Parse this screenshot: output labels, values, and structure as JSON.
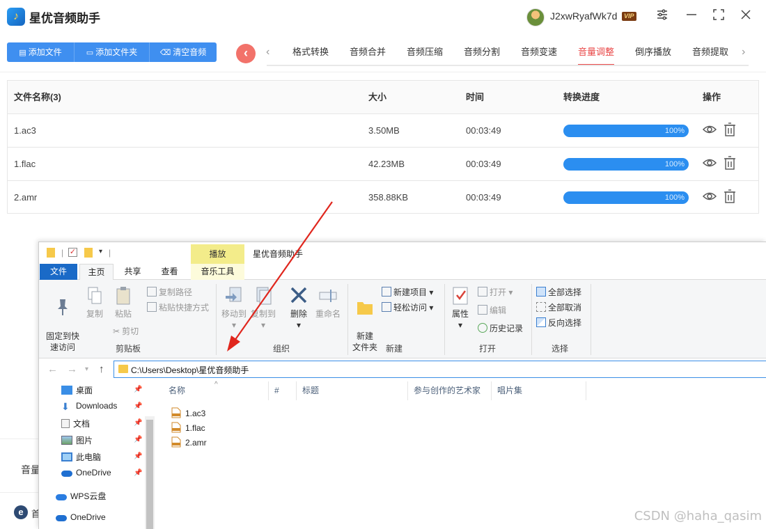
{
  "app": {
    "title": "星优音频助手",
    "user_name": "J2xwRyafWk7d",
    "vip": "VIP"
  },
  "toolbar": {
    "add_file": "添加文件",
    "add_folder": "添加文件夹",
    "clear_audio": "清空音频"
  },
  "tabs": [
    {
      "label": "格式转换",
      "active": false
    },
    {
      "label": "音频合并",
      "active": false
    },
    {
      "label": "音频压缩",
      "active": false
    },
    {
      "label": "音频分割",
      "active": false
    },
    {
      "label": "音频变速",
      "active": false
    },
    {
      "label": "音量调整",
      "active": true
    },
    {
      "label": "倒序播放",
      "active": false
    },
    {
      "label": "音频提取",
      "active": false
    }
  ],
  "table": {
    "headers": {
      "name": "文件名称(3)",
      "size": "大小",
      "time": "时间",
      "progress": "转换进度",
      "ops": "操作"
    },
    "rows": [
      {
        "name": "1.ac3",
        "size": "3.50MB",
        "time": "00:03:49",
        "progress": "100%"
      },
      {
        "name": "1.flac",
        "size": "42.23MB",
        "time": "00:03:49",
        "progress": "100%"
      },
      {
        "name": "2.amr",
        "size": "358.88KB",
        "time": "00:03:49",
        "progress": "100%"
      }
    ]
  },
  "background": {
    "volume_label": "音量",
    "ie_text": "首"
  },
  "explorer": {
    "context_tab": "播放",
    "title": "星优音频助手",
    "ribbon_tabs": {
      "file": "文件",
      "home": "主页",
      "share": "共享",
      "view": "查看",
      "music": "音乐工具"
    },
    "ribbon": {
      "pin_quick_access": "固定到快\n速访问",
      "copy": "复制",
      "paste": "粘贴",
      "copy_path": "复制路径",
      "paste_shortcut": "粘贴快捷方式",
      "cut": "剪切",
      "group_clipboard": "剪贴板",
      "move_to": "移动到",
      "copy_to": "复制到",
      "delete": "删除",
      "rename": "重命名",
      "group_organize": "组织",
      "new_folder": "新建\n文件夹",
      "new_item": "新建项目",
      "easy_access": "轻松访问",
      "group_new": "新建",
      "properties": "属性",
      "open": "打开",
      "edit": "编辑",
      "history": "历史记录",
      "group_open": "打开",
      "select_all": "全部选择",
      "select_none": "全部取消",
      "invert_selection": "反向选择",
      "group_select": "选择"
    },
    "address": "C:\\Users\\Desktop\\星优音频助手",
    "nav": [
      {
        "label": "桌面",
        "icon": "desktop-icon",
        "pinned": true
      },
      {
        "label": "Downloads",
        "icon": "download-icon",
        "pinned": true
      },
      {
        "label": "文档",
        "icon": "document-icon",
        "pinned": true
      },
      {
        "label": "图片",
        "icon": "picture-icon",
        "pinned": true
      },
      {
        "label": "此电脑",
        "icon": "computer-icon",
        "pinned": true
      },
      {
        "label": "OneDrive",
        "icon": "cloud-icon",
        "pinned": true
      },
      {
        "label": "WPS云盘",
        "icon": "cloud-icon",
        "pinned": false
      },
      {
        "label": "OneDrive",
        "icon": "cloud-icon",
        "pinned": false
      }
    ],
    "columns": [
      "名称",
      "#",
      "标题",
      "参与创作的艺术家",
      "唱片集"
    ],
    "files": [
      "1.ac3",
      "1.flac",
      "2.amr"
    ]
  },
  "watermark": "CSDN @haha_qasim",
  "colors": {
    "accent": "#3f8ff0",
    "active_tab": "#e94848",
    "progress": "#2b8ef0",
    "back_button": "#f2726a"
  }
}
